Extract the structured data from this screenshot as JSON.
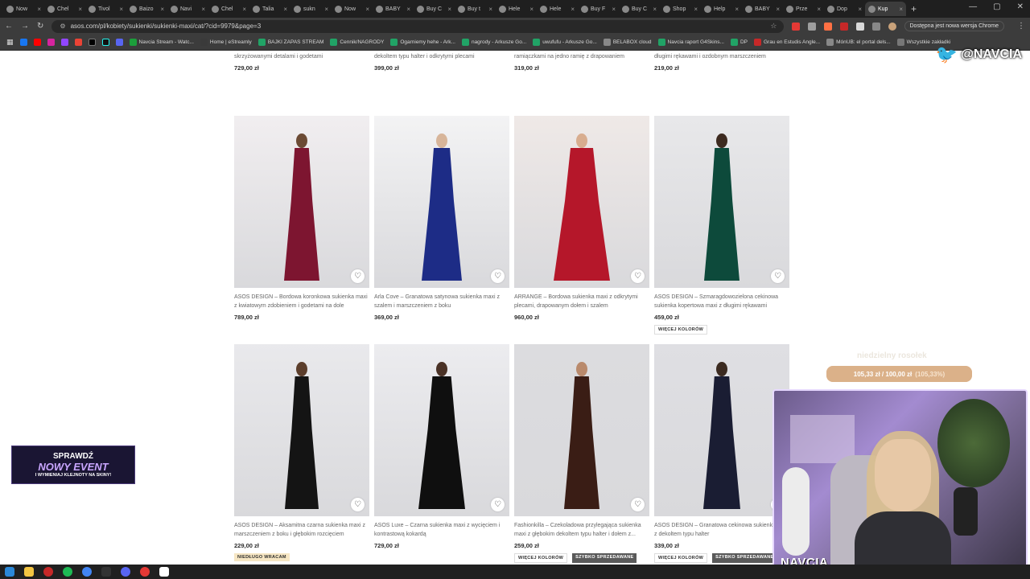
{
  "browser": {
    "tabs": [
      {
        "label": "Now"
      },
      {
        "label": "Chel"
      },
      {
        "label": "Tivol"
      },
      {
        "label": "Baizo"
      },
      {
        "label": "Navi"
      },
      {
        "label": "Chel"
      },
      {
        "label": "Talia"
      },
      {
        "label": "sukn"
      },
      {
        "label": "Now"
      },
      {
        "label": "BABY"
      },
      {
        "label": "Buy C"
      },
      {
        "label": "Buy t"
      },
      {
        "label": "Hele"
      },
      {
        "label": "Hele"
      },
      {
        "label": "Buy F"
      },
      {
        "label": "Buy C"
      },
      {
        "label": "Shop"
      },
      {
        "label": "Help"
      },
      {
        "label": "BABY"
      },
      {
        "label": "Prze"
      },
      {
        "label": "Dop"
      },
      {
        "label": "Kup"
      }
    ],
    "url": "asos.com/pl/kobiety/sukienki/sukienki-maxi/cat/?cid=9979&page=3",
    "update_pill": "Dostępna jest nowa wersja Chrome",
    "bookmarks": [
      {
        "label": "Navcia Stream - Watc...",
        "color": "#1c9e3b"
      },
      {
        "label": "Home | eStreamly",
        "color": "#3a3a3a"
      },
      {
        "label": "BAJKI ZAPAS STREAM",
        "color": "#21a366"
      },
      {
        "label": "Cennik/NAGRODY",
        "color": "#21a366"
      },
      {
        "label": "Ogarniemy hehe - Ark...",
        "color": "#21a366"
      },
      {
        "label": "nagrody - Arkusze Go...",
        "color": "#21a366"
      },
      {
        "label": "uwufufu - Arkusze Go...",
        "color": "#21a366"
      },
      {
        "label": "BELABOX cloud",
        "color": "#888888"
      },
      {
        "label": "Navcia raport G4Skins...",
        "color": "#21a366"
      },
      {
        "label": "DP",
        "color": "#21a366"
      },
      {
        "label": "Grau en Estudis Angle...",
        "color": "#c62828"
      },
      {
        "label": "MónUB: el portal dels...",
        "color": "#888888"
      },
      {
        "label": "Wszystkie zakładki",
        "color": "#777777"
      }
    ]
  },
  "products": [
    {
      "title": "Forever New – Kremowa sukienka maxi ze skrzyżowanymi detalami i godetami",
      "price": "729,00 zł",
      "badges": []
    },
    {
      "title": "TFNC – Czekoladowa siateczkowa sukienka maxi z dekoltem typu halter i odkrytymi plecami",
      "price": "399,00 zł",
      "badges": []
    },
    {
      "title": "ASOS DESIGN – Czarna cekinowa sukienka maxi z ramiączkami na jedno ramię z drapowaniem",
      "price": "319,00 zł",
      "badges": []
    },
    {
      "title": "ASOS DESIGN – Szałwiowa sukienka maxi z golfem, długimi rękawami i ozdobnym marszczeniem",
      "price": "219,00 zł",
      "badges": []
    },
    {
      "title": "ASOS DESIGN – Bordowa koronkowa sukienka maxi z kwiatowym zdobieniem i godetami na dole",
      "price": "789,00 zł",
      "badges": []
    },
    {
      "title": "Arla Cove – Granatowa satynowa sukienka maxi z szalem i marszczeniem z boku",
      "price": "369,00 zł",
      "badges": []
    },
    {
      "title": "ARRANGE – Bordowa sukienka maxi z odkrytymi plecami, drapowanym dołem i szalem",
      "price": "960,00 zł",
      "badges": []
    },
    {
      "title": "ASOS DESIGN – Szmaragdowozielona cekinowa sukienka kopertowa maxi z długimi rękawami",
      "price": "459,00 zł",
      "badges": [
        "WIĘCEJ KOLORÓW"
      ]
    },
    {
      "title": "ASOS DESIGN – Aksamitna czarna sukienka maxi z marszczeniem z boku i głębokim rozcięciem",
      "price": "229,00 zł",
      "badges": [
        "NIEDŁUGO WRACAM"
      ]
    },
    {
      "title": "ASOS Luxe – Czarna sukienka maxi z wycięciem i kontrastową kokardą",
      "price": "729,00 zł",
      "badges": []
    },
    {
      "title": "Fashionkilla – Czekoladowa przylegająca sukienka maxi z głębokim dekoltem typu halter i dołem z...",
      "price": "259,00 zł",
      "badges": [
        "WIĘCEJ KOLORÓW",
        "SZYBKO SPRZEDAWANE"
      ]
    },
    {
      "title": "ASOS DESIGN – Granatowa cekinowa sukienka maxi z dekoltem typu halter",
      "price": "339,00 zł",
      "badges": [
        "WIĘCEJ KOLORÓW",
        "SZYBKO SPRZEDAWANE"
      ]
    }
  ],
  "overlay": {
    "twitter_handle": "@NAVCIA",
    "goal_title": "niedzielny rosołek",
    "goal_amount": "105,33 zł / 100,00 zł",
    "goal_percent": "(105,33%)",
    "goal_fraction": 1.0,
    "event_line1": "SPRAWDŹ",
    "event_line2": "NOWY EVENT",
    "event_line3": "I WYMIENIAJ KLEJNOTY NA SKINY!",
    "webcam_name": "NAVCIA"
  }
}
